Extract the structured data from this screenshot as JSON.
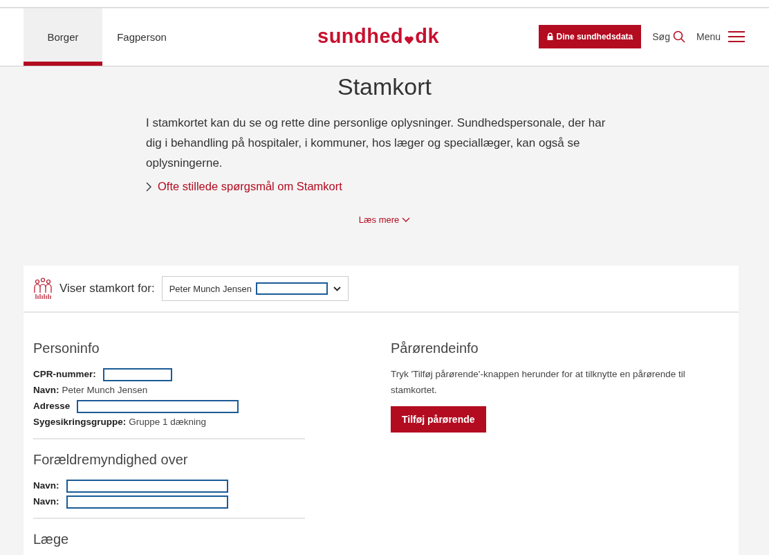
{
  "header": {
    "tabs": [
      {
        "label": "Borger",
        "selected": true
      },
      {
        "label": "Fagperson",
        "selected": false
      }
    ],
    "logo": {
      "before": "sundhed",
      "after": "dk"
    },
    "data_button": "Dine sundhedsdata",
    "search": "Søg",
    "menu": "Menu"
  },
  "page": {
    "title": "Stamkort",
    "intro": "I stamkortet kan du se og rette dine personlige oplysninger. Sundhedspersonale, der har dig i behandling på hospitaler, i kommuner, hos læger og speciallæger, kan også se oplysningerne.",
    "faq_link": "Ofte stillede spørgsmål om Stamkort",
    "read_more": "Læs mere"
  },
  "card": {
    "selector_label": "Viser stamkort for:",
    "selector_value": "Peter Munch Jensen",
    "selector_redacted": true,
    "person": {
      "title": "Personinfo",
      "rows": [
        {
          "label": "CPR-nummer:",
          "redacted": true
        },
        {
          "label": "Navn:",
          "value": "Peter Munch Jensen",
          "redacted": false
        },
        {
          "label": "Adresse",
          "redacted": true
        },
        {
          "label": "Sygesikringsgruppe:",
          "value": "Gruppe 1 dækning",
          "redacted": false
        }
      ]
    },
    "custody": {
      "title": "Forældremyndighed over",
      "rows": [
        {
          "label": "Navn:",
          "redacted": true
        },
        {
          "label": "Navn:",
          "redacted": true
        }
      ]
    },
    "doctor": {
      "title": "Læge"
    },
    "relatives": {
      "title": "Pårørendeinfo",
      "text": "Tryk 'Tilføj pårørende'-knappen herunder for at tilknytte en pårørende til stamkortet.",
      "button": "Tilføj pårørende"
    }
  }
}
